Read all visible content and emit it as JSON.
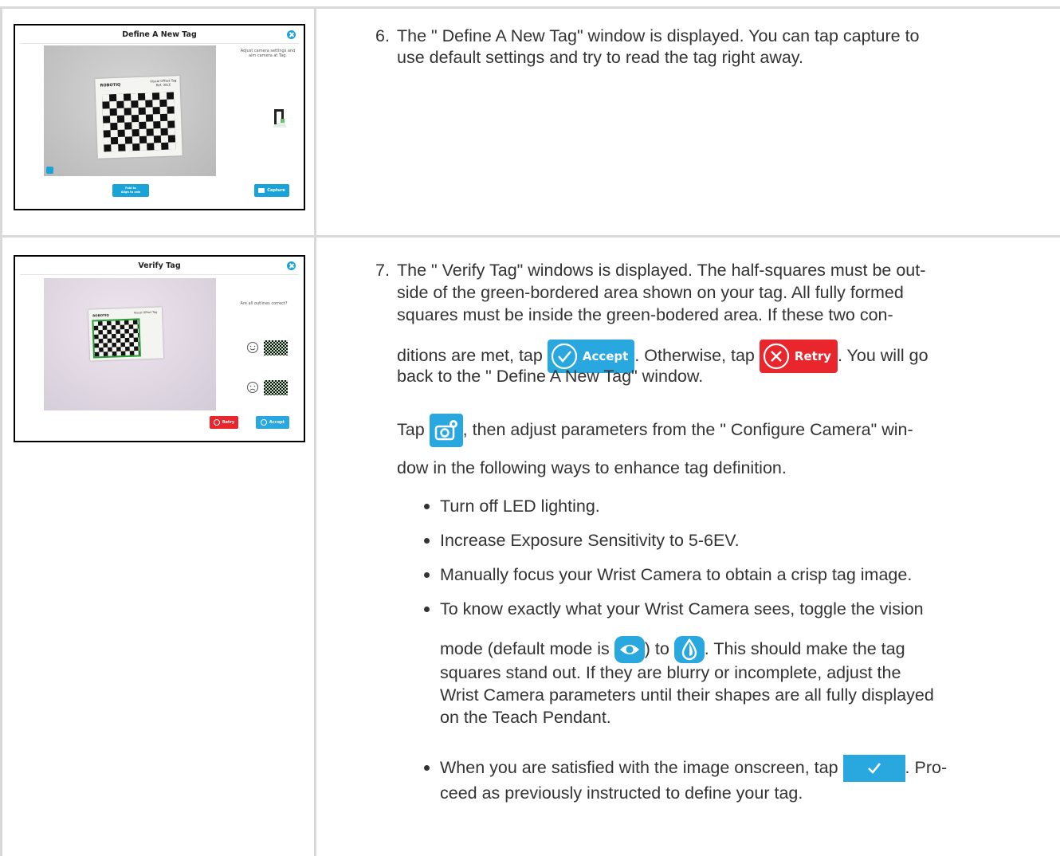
{
  "step6": {
    "number": "6.",
    "text_line1": "The \" Define A New Tag\"  window is displayed. You can tap capture to",
    "text_line2": "use default settings and try to read the tag right away.",
    "screenshot": {
      "title": "Define A New Tag",
      "hint_line1": "Adjust camera settings and",
      "hint_line2": "aim camera at Tag.",
      "tag_brand": "ROBOTIQ",
      "tag_label_line1": "Visual Offset Tag",
      "tag_label_line2": "Ref. 30LE",
      "fold_button_line1": "Fold to",
      "fold_button_line2": "Align to axis",
      "capture_button": "Capture"
    }
  },
  "step7": {
    "number": "7.",
    "line1": "The \" Verify Tag\"  windows is displayed. The half-squares must be out-",
    "line2": "side of the green-bordered area shown on your tag. All fully formed",
    "line3": "squares must be inside the green-bodered area. If these two con-",
    "line4_a": "ditions are met, tap",
    "line4_b": ". Otherwise, tap",
    "line4_c": ". You will go",
    "line5": "back to the \" Define A New Tag\"  window.",
    "accept_label": "Accept",
    "retry_label": "Retry",
    "tap_a": "Tap",
    "tap_b": ", then adjust parameters from the \" Configure Camera\"  win-",
    "tap_c": "dow in the following ways to enhance tag definition.",
    "bullets": {
      "b1": "Turn off LED lighting.",
      "b2": "Increase Exposure Sensitivity to 5-6EV.",
      "b3": "Manually focus your Wrist Camera to obtain a crisp tag image.",
      "b4_line1": "To know exactly what your Wrist Camera sees, toggle the vision",
      "b4_a": "mode (default mode is",
      "b4_b": ") to",
      "b4_c": ". This should make the tag",
      "b4_line3": "squares stand out. If they are blurry or incomplete, adjust the",
      "b4_line4": "Wrist Camera parameters until their shapes are all fully displayed",
      "b4_line5": "on the Teach Pendant.",
      "b5_a": "When you are satisfied with the image onscreen, tap",
      "b5_b": ". Pro-",
      "b5_line2": "ceed as previously instructed to define your tag."
    },
    "screenshot": {
      "title": "Verify Tag",
      "question": "Are all outlines correct?",
      "retry_button": "Retry",
      "accept_button": "Accept",
      "tag_brand": "ROBOTIQ",
      "tag_label": "Visual Offset Tag"
    }
  },
  "colors": {
    "accent_blue": "#1aa3d9",
    "retry_red": "#e8262c",
    "ok_blue": "#29a8e0"
  }
}
